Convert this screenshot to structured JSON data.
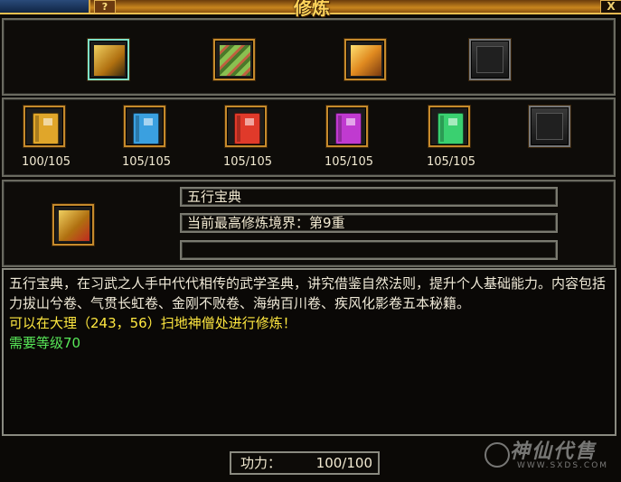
{
  "window": {
    "title": "修炼",
    "help_label": "?",
    "close_label": "X"
  },
  "categories": [
    {
      "name": "book-bundle-icon",
      "color": "#c79a2a",
      "selected": true
    },
    {
      "name": "scroll-bundle-icon",
      "color": "#6ea83a",
      "selected": false
    },
    {
      "name": "gold-bundle-icon",
      "color": "#d98a22",
      "selected": false
    },
    {
      "name": "empty-slot",
      "color": "#3a3a3a",
      "selected": false
    }
  ],
  "books": [
    {
      "color": "#e0a62a",
      "count": "100/105"
    },
    {
      "color": "#3aa0e0",
      "count": "105/105"
    },
    {
      "color": "#e03a2a",
      "count": "105/105"
    },
    {
      "color": "#c03ad0",
      "count": "105/105"
    },
    {
      "color": "#3ad070",
      "count": "105/105"
    },
    {
      "color": "#2a2a2a",
      "count": ""
    }
  ],
  "detail": {
    "name": "五行宝典",
    "level_text": "当前最高修炼境界：第9重",
    "extra_text": ""
  },
  "description": {
    "body": "五行宝典，在习武之人手中代代相传的武学圣典，讲究借鉴自然法则，提升个人基础能力。内容包括力拔山兮卷、气贯长虹卷、金刚不败卷、海纳百川卷、疾风化影卷五本秘籍。",
    "location": "可以在大理（243，56）扫地神僧处进行修炼！",
    "requirement": "需要等级70"
  },
  "gongli": {
    "label": "功力：",
    "value": "100/100"
  },
  "watermark": {
    "text": "神仙代售",
    "url": "WWW.SXDS.COM"
  }
}
